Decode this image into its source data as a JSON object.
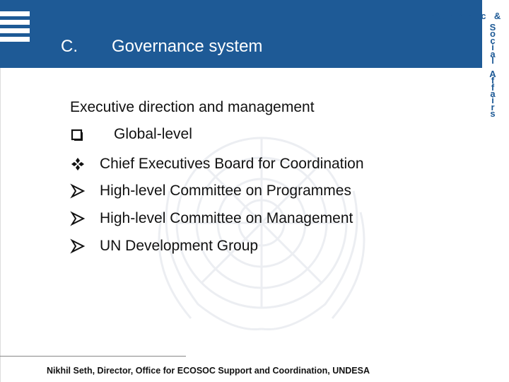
{
  "header": {
    "section_letter": "C.",
    "section_title": "Governance system"
  },
  "brand": {
    "horizontal": "Economic &",
    "vertical": [
      "S",
      "o",
      "c",
      "i",
      "a",
      "l",
      " ",
      "A",
      "f",
      "f",
      "a",
      "i",
      "r",
      "s"
    ]
  },
  "content": {
    "subtitle": "Executive direction and management",
    "level_heading": {
      "bullet_icon": "square-bullet-icon",
      "text": "Global-level"
    },
    "items": [
      {
        "bullet_icon": "diamond-clover-bullet-icon",
        "text": "Chief Executives Board for Coordination"
      },
      {
        "bullet_icon": "arrowhead-bullet-icon",
        "text": "High-level Committee on Programmes"
      },
      {
        "bullet_icon": "arrowhead-bullet-icon",
        "text": "High-level Committee on Management"
      },
      {
        "bullet_icon": "arrowhead-bullet-icon",
        "text": "UN Development Group"
      }
    ]
  },
  "footer": {
    "text": "Nikhil Seth, Director, Office for ECOSOC Support and Coordination, UNDESA"
  },
  "colors": {
    "header_blue": "#1e5a96",
    "text": "#111111"
  }
}
